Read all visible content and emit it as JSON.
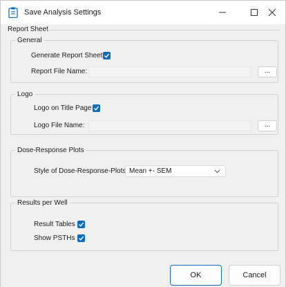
{
  "window": {
    "title": "Save Analysis Settings",
    "icons": {
      "app": "clipboard-icon",
      "minimize": "minimize-icon",
      "maximize": "maximize-icon",
      "close": "close-icon"
    }
  },
  "report_sheet": {
    "legend": "Report Sheet",
    "general": {
      "legend": "General",
      "generate_label": "Generate Report Sheet",
      "generate_checked": true,
      "file_name_label": "Report File Name:",
      "file_name_value": "",
      "browse_label": "..."
    },
    "logo": {
      "legend": "Logo",
      "on_title_label": "Logo on Title Page",
      "on_title_checked": true,
      "file_name_label": "Logo File Name:",
      "file_name_value": "",
      "browse_label": "..."
    },
    "dose_response": {
      "legend": "Dose-Response Plots",
      "style_label": "Style of Dose-Response-Plots:",
      "style_value": "Mean +- SEM"
    },
    "results": {
      "legend": "Results per Well",
      "result_tables_label": "Result Tables",
      "result_tables_checked": true,
      "show_psths_label": "Show PSTHs",
      "show_psths_checked": true
    }
  },
  "footer": {
    "ok_label": "OK",
    "cancel_label": "Cancel"
  },
  "colors": {
    "accent": "#0f6cbd",
    "background": "#f0f0f0"
  }
}
